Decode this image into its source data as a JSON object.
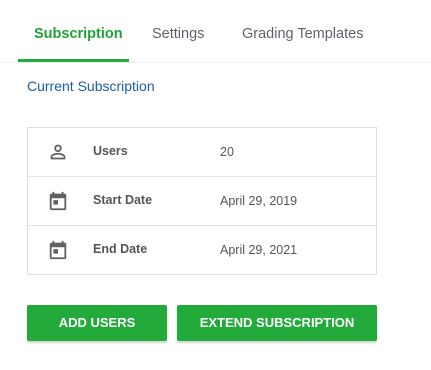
{
  "tabs": [
    {
      "label": "Subscription",
      "active": true
    },
    {
      "label": "Settings",
      "active": false
    },
    {
      "label": "Grading Templates",
      "active": false
    }
  ],
  "section_title": "Current Subscription",
  "details": [
    {
      "icon": "person-icon",
      "label": "Users",
      "value": "20"
    },
    {
      "icon": "calendar-icon",
      "label": "Start Date",
      "value": "April 29, 2019"
    },
    {
      "icon": "calendar-icon",
      "label": "End Date",
      "value": "April 29, 2021"
    }
  ],
  "buttons": {
    "add_users": "ADD USERS",
    "extend_subscription": "EXTEND SUBSCRIPTION"
  },
  "colors": {
    "accent_green": "#22ab3a",
    "link_blue": "#1a5ea8",
    "icon_gray": "#616161"
  }
}
